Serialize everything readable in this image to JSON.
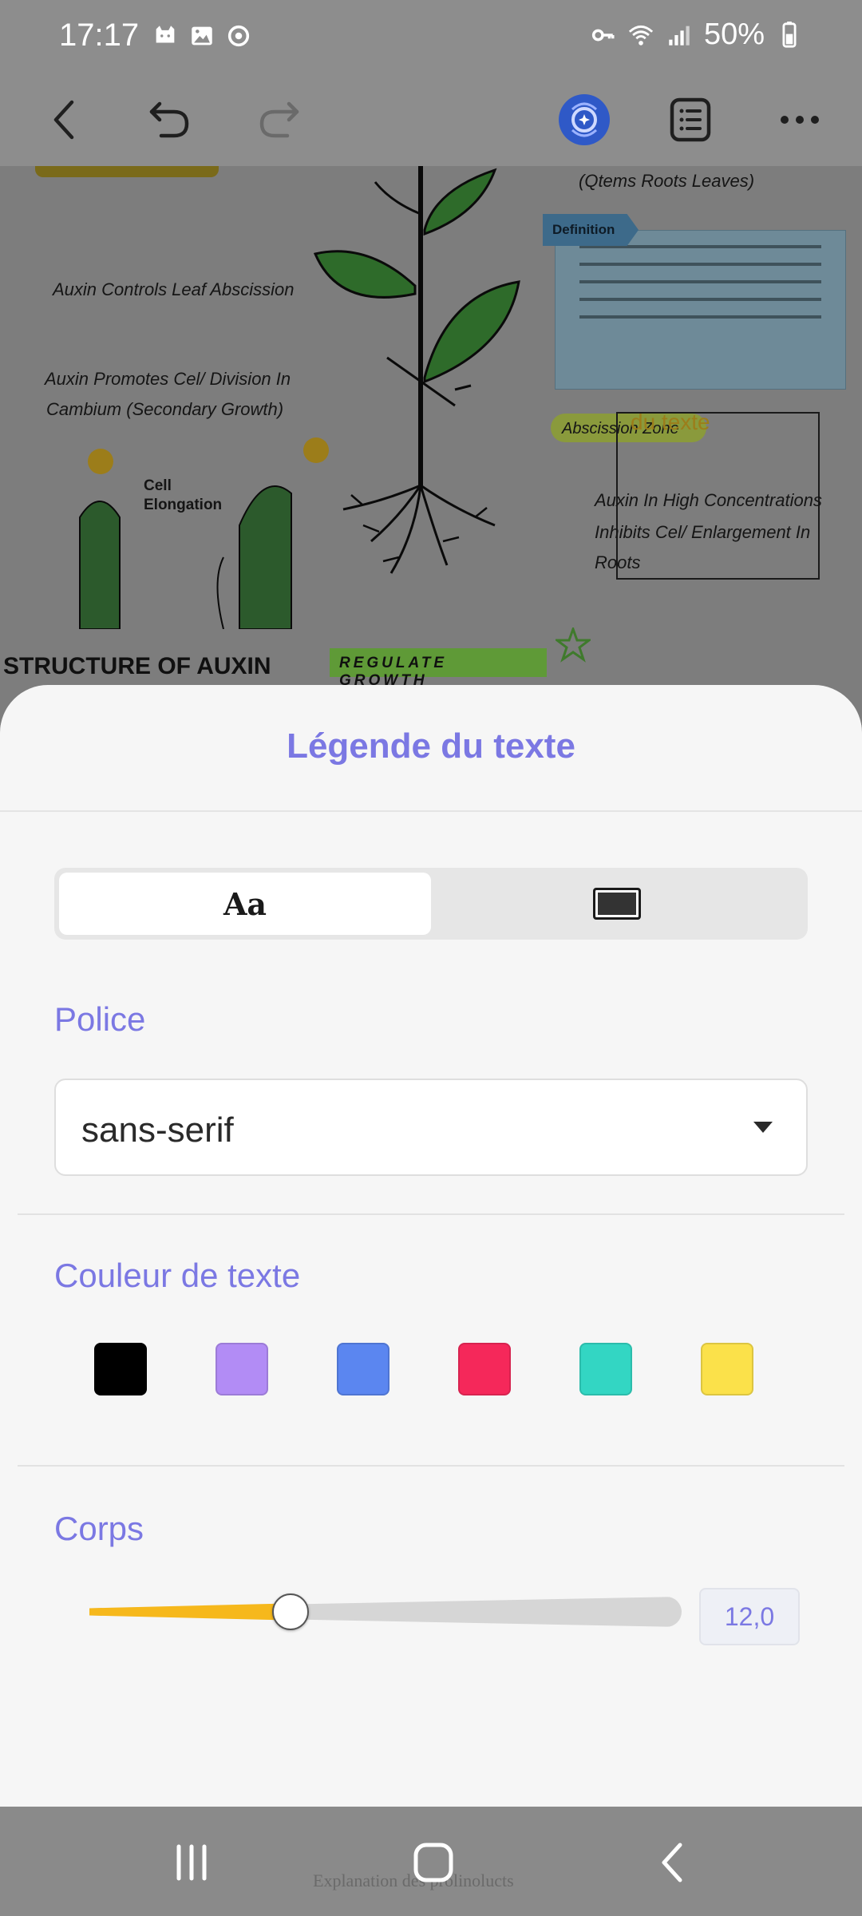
{
  "status_bar": {
    "time": "17:17",
    "battery": "50%",
    "left_icons": [
      "cat-icon",
      "image-icon",
      "sync-icon"
    ],
    "right_icons": [
      "key-icon",
      "wifi-icon",
      "signal-icon",
      "battery-icon"
    ]
  },
  "toolbar": {
    "icons": [
      "back-icon",
      "undo-icon",
      "redo-icon",
      "ai-assistant-icon",
      "outline-icon",
      "more-icon"
    ]
  },
  "document": {
    "labels": {
      "stems_roots_leaves": "(Qtems Roots Leaves)",
      "definition": "Definition",
      "auxin_leaf_abscission": "Auxin Controls Leaf Abscission",
      "auxin_cell_division_line1": "Auxin Promotes Cel/ Division In",
      "auxin_cell_division_line2": "Cambium (Secondary Growth)",
      "abscission_zone": "Abscission Zone",
      "cell_elongation_line1": "Cell",
      "cell_elongation_line2": "Elongation",
      "auxin_high_line1": "Auxin In High Concentrations",
      "auxin_high_line2": "Inhibits Cel/ Enlargement In",
      "auxin_high_line3": "Roots",
      "structure_heading": "STRUCTURE OF AUXIN",
      "regulate_growth": "REGULATE GROWTH",
      "selection_label": "du texte"
    }
  },
  "sheet": {
    "title": "Légende du texte",
    "segment": {
      "text_option": "Aa",
      "box_option_icon": "box-style-icon",
      "selected": "text"
    },
    "font_section": {
      "label": "Police",
      "value": "sans-serif"
    },
    "color_section": {
      "label": "Couleur de texte",
      "swatches": [
        "#000000",
        "#b28cf5",
        "#5b86f0",
        "#f5285a",
        "#33d6c3",
        "#fbe14a"
      ]
    },
    "size_section": {
      "label": "Corps",
      "value": "12,0",
      "slider_fraction": 0.34
    }
  },
  "nav_bar": {
    "buttons": [
      "recent-apps-icon",
      "home-icon",
      "back-nav-icon"
    ],
    "behind_text": "Explanation des prolinolucts"
  },
  "colors": {
    "accent": "#7b78e3",
    "slider_fill": "#f6b81c"
  }
}
